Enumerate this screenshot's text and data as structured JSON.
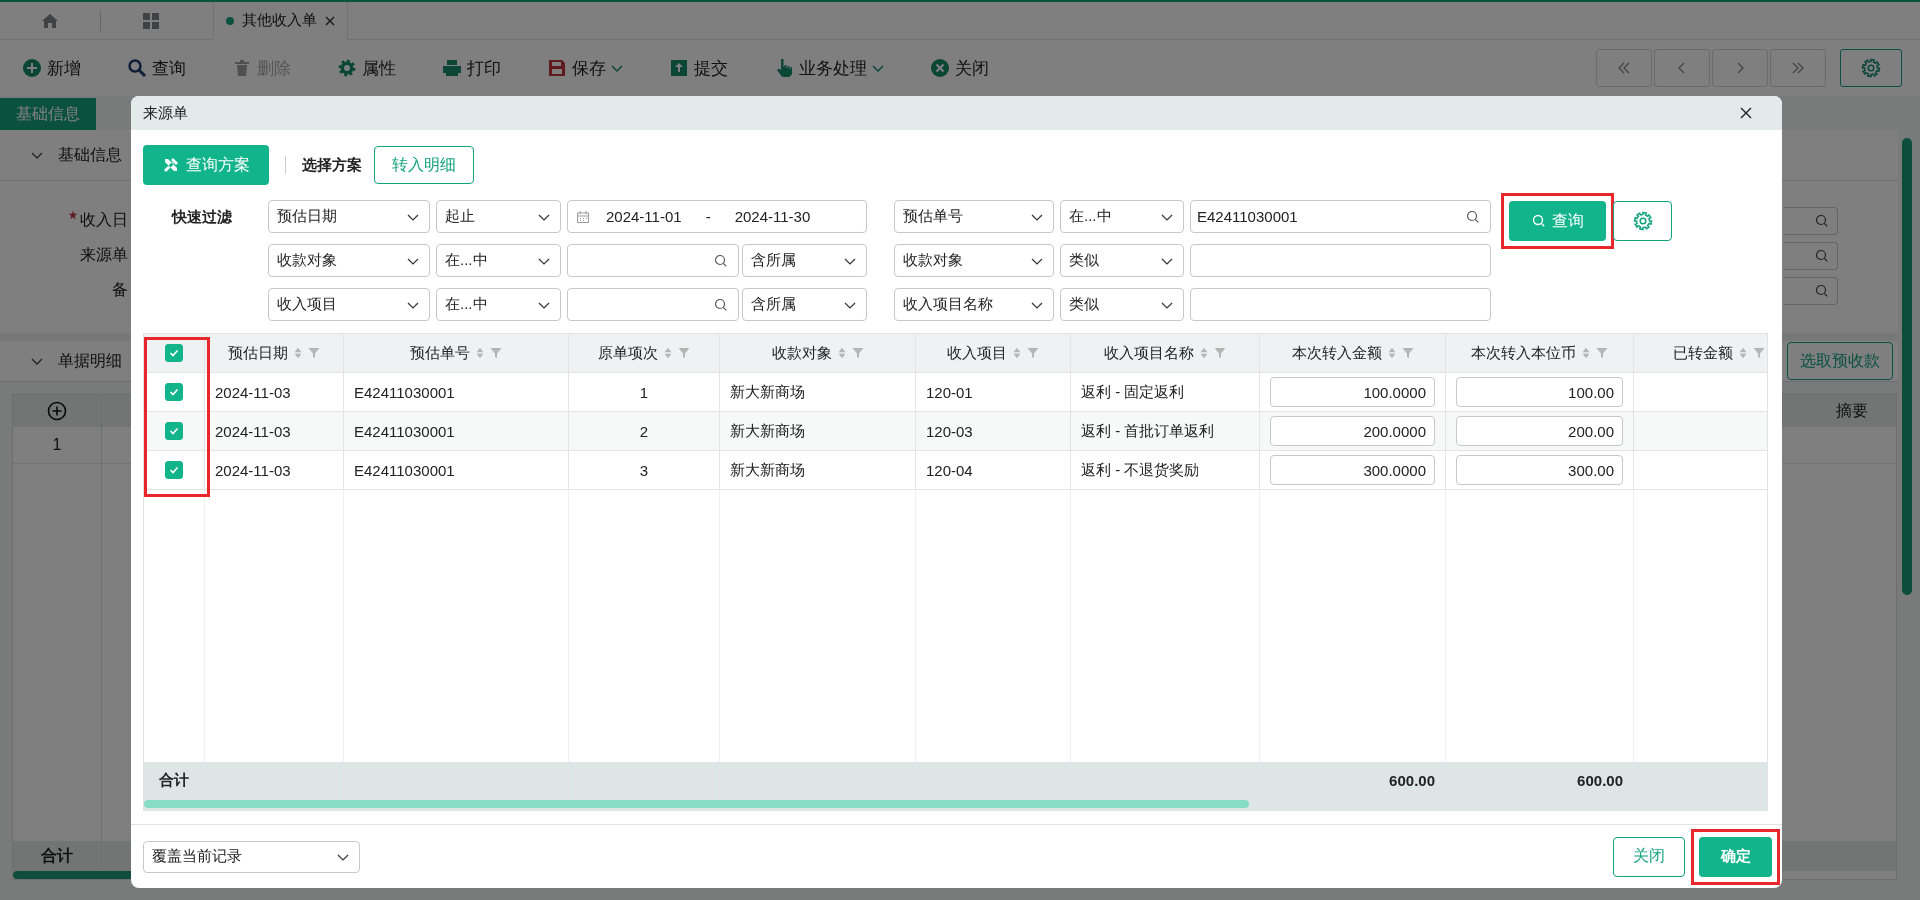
{
  "tab_bar": {
    "tabs": [
      {
        "label": "其他收入单",
        "selected": true
      }
    ]
  },
  "toolbar": {
    "items": [
      {
        "label": "新增",
        "disabled": false,
        "dropdown": false
      },
      {
        "label": "查询",
        "disabled": false,
        "dropdown": false
      },
      {
        "label": "删除",
        "disabled": true,
        "dropdown": false
      },
      {
        "label": "属性",
        "disabled": false,
        "dropdown": false
      },
      {
        "label": "打印",
        "disabled": false,
        "dropdown": false
      },
      {
        "label": "保存",
        "disabled": false,
        "dropdown": true
      },
      {
        "label": "提交",
        "disabled": false,
        "dropdown": false
      },
      {
        "label": "业务处理",
        "disabled": false,
        "dropdown": true
      },
      {
        "label": "关闭",
        "disabled": false,
        "dropdown": false
      }
    ]
  },
  "page_tabs": [
    {
      "label": "基础信息",
      "selected": true
    }
  ],
  "basic_section": {
    "title": "基础信息",
    "expanded": true,
    "fields": [
      {
        "label": "收入日",
        "required": true
      },
      {
        "label": "来源单",
        "required": false
      },
      {
        "label": "备",
        "required": false
      }
    ]
  },
  "detail_section": {
    "title": "单据明细",
    "expanded": true,
    "button": "选取预收款",
    "last_column": "摘要",
    "rows": [
      "1"
    ],
    "total_label": "合计"
  },
  "dialog": {
    "title": "来源单",
    "scheme_button": "查询方案",
    "scheme_label": "选择方案",
    "detail_button": "转入明细",
    "filter_label": "快速过滤",
    "filters": [
      {
        "kind": "date",
        "field": "预估日期",
        "operator": "起止",
        "from": "2024-11-01",
        "separator": "-",
        "to": "2024-11-30",
        "field_2": "预估单号",
        "operator_2": "在...中",
        "value_2": "E42411030001"
      },
      {
        "kind": "lookup",
        "field": "收款对象",
        "operator": "在...中",
        "scope": "含所属",
        "field_2": "收款对象",
        "operator_2": "类似"
      },
      {
        "kind": "lookup",
        "field": "收入项目",
        "operator": "在...中",
        "scope": "含所属",
        "field_2": "收入项目名称",
        "operator_2": "类似"
      }
    ],
    "query_button": {
      "label": "查询",
      "highlighted": true
    },
    "table": {
      "all_selected": true,
      "select_highlighted": true,
      "total_label": "合计",
      "columns": [
        {
          "label": "预估日期",
          "kind": "text"
        },
        {
          "label": "预估单号",
          "kind": "text"
        },
        {
          "label": "原单项次",
          "kind": "text"
        },
        {
          "label": "收款对象",
          "kind": "text"
        },
        {
          "label": "收入项目",
          "kind": "text"
        },
        {
          "label": "收入项目名称",
          "kind": "text"
        },
        {
          "label": "本次转入金额",
          "kind": "input",
          "total": "600.00"
        },
        {
          "label": "本次转入本位币",
          "kind": "input",
          "total": "600.00"
        },
        {
          "label": "已转金额",
          "kind": "text"
        }
      ],
      "rows": [
        {
          "selected": true,
          "cells": [
            "2024-11-03",
            "E42411030001",
            "1",
            "新大新商场",
            "120-01",
            "返利 - 固定返利",
            "100.0000",
            "100.00"
          ]
        },
        {
          "selected": true,
          "cells": [
            "2024-11-03",
            "E42411030001",
            "2",
            "新大新商场",
            "120-03",
            "返利 - 首批订单返利",
            "200.0000",
            "200.00"
          ]
        },
        {
          "selected": true,
          "cells": [
            "2024-11-03",
            "E42411030001",
            "3",
            "新大新商场",
            "120-04",
            "返利 - 不退货奖励",
            "300.0000",
            "300.00"
          ]
        }
      ]
    },
    "mode_select": "覆盖当前记录",
    "close_button": "关闭",
    "ok_button": {
      "label": "确定",
      "highlighted": true
    }
  }
}
